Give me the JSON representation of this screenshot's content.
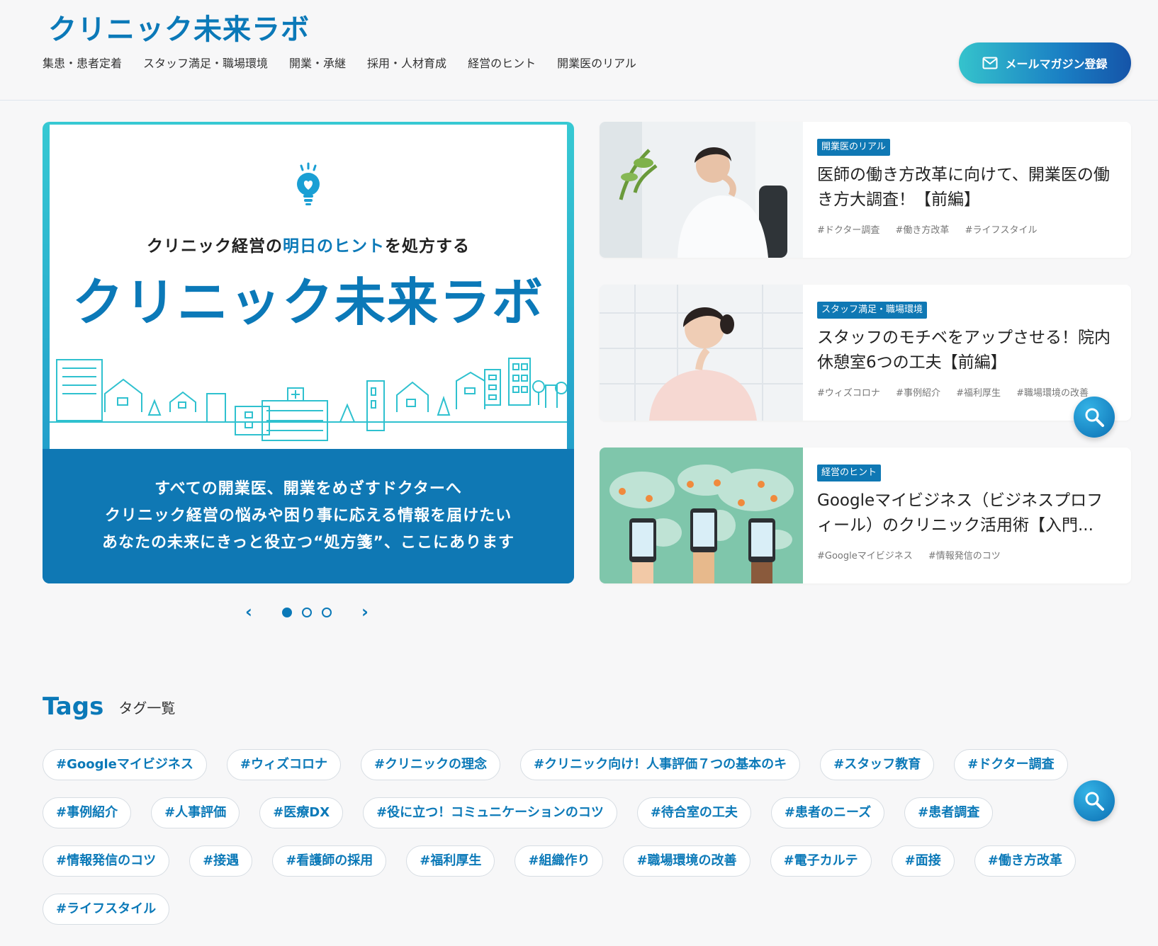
{
  "header": {
    "logo": "クリニック未来ラボ",
    "nav": [
      "集患・患者定着",
      "スタッフ満足・職場環境",
      "開業・承継",
      "採用・人材育成",
      "経営のヒント",
      "開業医のリアル"
    ],
    "mail_button": "メールマガジン登録"
  },
  "hero": {
    "tagline_pre": "クリニック経営の",
    "tagline_highlight": "明日のヒント",
    "tagline_post": "を処方する",
    "logo": "クリニック未来ラボ",
    "lines": [
      "すべての開業医、開業をめざすドクターへ",
      "クリニック経営の悩みや困り事に応える情報を届けたい",
      "あなたの未来にきっと役立つ“処方箋”、ここにあります"
    ],
    "prev_glyph": "‹",
    "next_glyph": "›",
    "slides_total": 3,
    "active_slide": 1
  },
  "articles": [
    {
      "category": "開業医のリアル",
      "title": "医師の働き方改革に向けて、開業医の働き方大調査！【前編】",
      "tags": [
        "#ドクター調査",
        "#働き方改革",
        "#ライフスタイル"
      ]
    },
    {
      "category": "スタッフ満足・職場環境",
      "title": "スタッフのモチベをアップさせる！院内休憩室6つの工夫【前編】",
      "tags": [
        "#ウィズコロナ",
        "#事例紹介",
        "#福利厚生",
        "#職場環境の改善"
      ]
    },
    {
      "category": "経営のヒント",
      "title": "Googleマイビジネス（ビジネスプロフィール）のクリニック活用術【入門...",
      "tags": [
        "#Googleマイビジネス",
        "#情報発信のコツ"
      ]
    }
  ],
  "tags_section": {
    "title_en": "Tags",
    "title_ja": "タグ一覧",
    "items": [
      "#Googleマイビジネス",
      "#ウィズコロナ",
      "#クリニックの理念",
      "#クリニック向け！人事評価７つの基本のキ",
      "#スタッフ教育",
      "#ドクター調査",
      "#事例紹介",
      "#人事評価",
      "#医療DX",
      "#役に立つ！コミュニケーションのコツ",
      "#待合室の工夫",
      "#患者のニーズ",
      "#患者調査",
      "#情報発信のコツ",
      "#接遇",
      "#看護師の採用",
      "#福利厚生",
      "#組織作り",
      "#職場環境の改善",
      "#電子カルテ",
      "#面接",
      "#働き方改革",
      "#ライフスタイル"
    ]
  },
  "colors": {
    "brand": "#0b79b8",
    "brand_dark": "#0f78b4",
    "accent": "#35c3cc"
  }
}
